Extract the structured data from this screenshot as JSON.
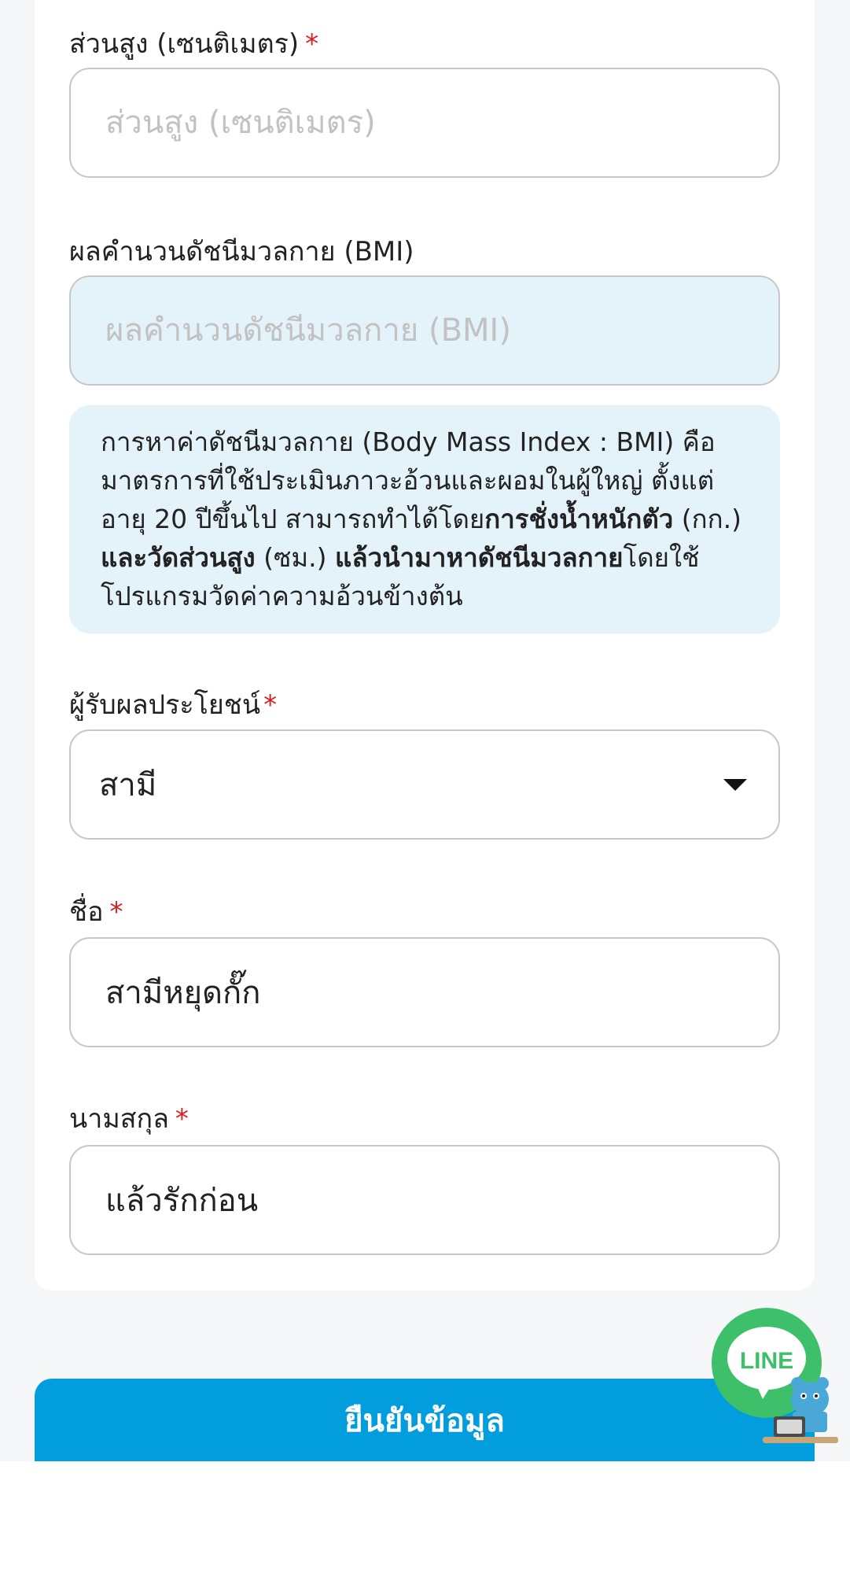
{
  "height_field": {
    "label": "ส่วนสูง (เซนติเมตร)",
    "required_mark": "*",
    "placeholder": "ส่วนสูง (เซนติเมตร)",
    "value": ""
  },
  "bmi_field": {
    "label": "ผลคำนวนดัชนีมวลกาย (BMI)",
    "placeholder": "ผลคำนวนดัชนีมวลกาย (BMI)",
    "value": ""
  },
  "bmi_info": {
    "part1": "การหาค่าดัชนีมวลกาย (Body Mass Index : BMI) คือ มาตรการที่ใช้ประเมินภาวะอ้วนและผอมในผู้ใหญ่ ตั้งแต่ อายุ 20 ปีขึ้นไป สามารถทำได้โดย",
    "bold1": "การชั่งน้ำหนักตัว",
    "part2": " (กก.) ",
    "bold2": "และวัดส่วนสูง",
    "part3": " (ซม.) ",
    "bold3": "แล้วนำมาหาดัชนีมวลกาย",
    "part4": "โดยใช้โปรแกรมวัดค่าความอ้วนข้างต้น"
  },
  "beneficiary_field": {
    "label": "ผู้รับผลประโยชน์",
    "required_mark": "*",
    "selected": "สามี"
  },
  "first_name_field": {
    "label": "ชื่อ",
    "required_mark": "*",
    "value": "สามีหยุดกั๊ก"
  },
  "last_name_field": {
    "label": "นามสกุล",
    "required_mark": "*",
    "value": "แล้วรักก่อน"
  },
  "submit": {
    "label": "ยืนยันข้อมูล"
  },
  "line_widget": {
    "label": "LINE"
  },
  "colors": {
    "accent": "#029ddc",
    "required": "#d81e1e",
    "readonly_bg": "#e4f2fa",
    "line_green": "#3ec06a"
  }
}
